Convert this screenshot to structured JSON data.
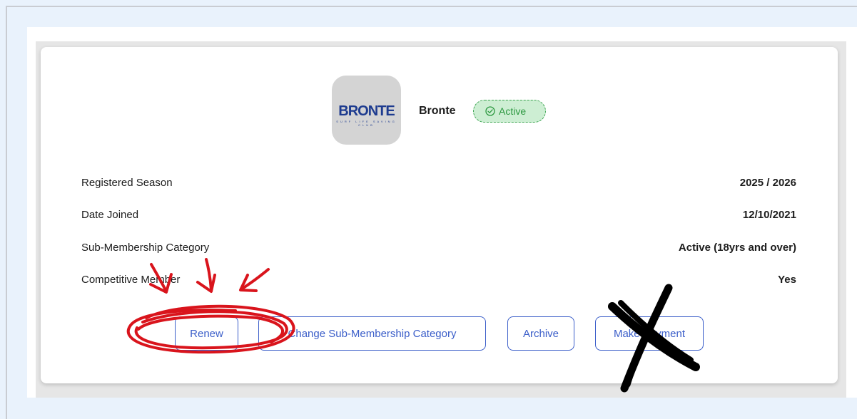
{
  "club": {
    "logo_text": "BRONTE",
    "logo_subtext": "SURF LIFE SAVING CLUB",
    "name": "Bronte",
    "status": "Active"
  },
  "details": [
    {
      "label": "Registered Season",
      "value": "2025 / 2026"
    },
    {
      "label": "Date Joined",
      "value": "12/10/2021"
    },
    {
      "label": "Sub-Membership Category",
      "value": "Active (18yrs and over)"
    },
    {
      "label": "Competitive Member",
      "value": "Yes"
    }
  ],
  "actions": {
    "renew": "Renew",
    "change_category": "Change Sub-Membership Category",
    "archive": "Archive",
    "make_payment": "Make Payment"
  },
  "colors": {
    "accent": "#3b5ec9",
    "status_green": "#2c9840",
    "status_bg": "#cdeed3",
    "annotation_red": "#d9141c",
    "annotation_black": "#000000"
  },
  "icons": {
    "status": "check-circle-icon"
  }
}
